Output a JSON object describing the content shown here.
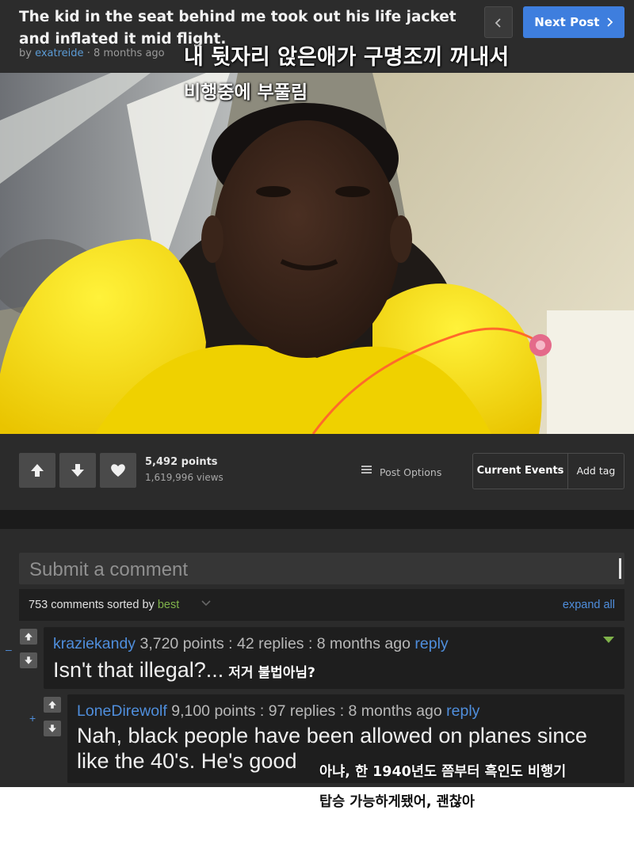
{
  "header": {
    "title": "The kid in the seat behind me took out his life jacket and inflated it mid flight.",
    "by_label": "by",
    "author": "exatreide",
    "time": "· 8 months ago",
    "next_label": "Next Post",
    "prev_icon": "chevron-left-icon",
    "next_icon": "chevron-right-icon",
    "accent_color": "#3e7ede"
  },
  "caption_ko": {
    "line1": "내 뒷자리 앉은애가 구명조끼 꺼내서",
    "line2": "비행중에 부풀림"
  },
  "photo": {
    "subject": "child wearing inflated yellow life vest in airplane seat"
  },
  "post_meta": {
    "points": "5,492 points",
    "views": "1,619,996 views",
    "post_options": "Post Options",
    "tag_current": "Current Events",
    "tag_add": "Add tag",
    "icons": [
      "upvote-icon",
      "downvote-icon",
      "favorite-heart-icon"
    ]
  },
  "comments_section": {
    "submit_placeholder": "Submit a comment",
    "sort_prefix": "753 comments sorted by",
    "sort_value": "best",
    "expand_all": "expand all",
    "link_color": "#4f8edc"
  },
  "comments": [
    {
      "collapse": "–",
      "user": "kraziekandy",
      "meta": "3,720 points : 42 replies : 8 months ago",
      "reply": "reply",
      "text": "Isn't that illegal?...",
      "ko": "저거 불법아님?"
    },
    {
      "collapse": "+",
      "user": "LoneDirewolf",
      "meta": "9,100 points : 97 replies : 8 months ago",
      "reply": "reply",
      "text": "Nah, black people have been allowed on planes since like the 40's. He's good",
      "ko_line1": "아냐, 한 1940년도 쯤부터 흑인도 비행기",
      "ko_line2": "탑승 가능하게됐어, 괜찮아"
    }
  ]
}
